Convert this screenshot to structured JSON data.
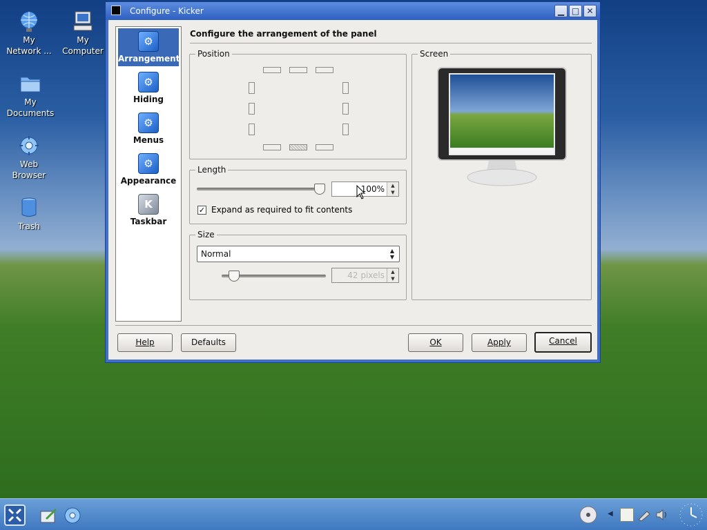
{
  "desktop": {
    "icons": [
      {
        "label": "My\nNetwork ...",
        "icon": "network-globe-icon"
      },
      {
        "label": "My\nComputer",
        "icon": "computer-icon"
      },
      {
        "label": "My\nDocuments",
        "icon": "folder-icon"
      },
      {
        "label": "Web\nBrowser",
        "icon": "web-browser-icon"
      },
      {
        "label": "Trash",
        "icon": "trash-icon"
      }
    ]
  },
  "window": {
    "title": "Configure - Kicker",
    "controls": {
      "minimize": "▁",
      "maximize": "□",
      "close": "✕"
    }
  },
  "sidebar": {
    "items": [
      {
        "label": "Arrangement",
        "active": true
      },
      {
        "label": "Hiding"
      },
      {
        "label": "Menus"
      },
      {
        "label": "Appearance"
      },
      {
        "label": "Taskbar"
      }
    ]
  },
  "main": {
    "heading": "Configure the arrangement of the panel",
    "position": {
      "legend": "Position",
      "selected": "bottom-center"
    },
    "screen": {
      "legend": "Screen"
    },
    "length": {
      "legend": "Length",
      "slider_value_percent": 100,
      "value_text": "100%",
      "expand_checked": true,
      "expand_label": "Expand as required to fit contents"
    },
    "size": {
      "legend": "Size",
      "selected": "Normal",
      "pixels_text": "42 pixels",
      "slider_fraction": 0.1
    }
  },
  "buttons": {
    "help": "Help",
    "defaults": "Defaults",
    "ok": "OK",
    "apply": "Apply",
    "cancel": "Cancel"
  },
  "colors": {
    "titlebar": "#2f5fc0",
    "selection": "#3a6ab7",
    "dialog_bg": "#efedea"
  }
}
